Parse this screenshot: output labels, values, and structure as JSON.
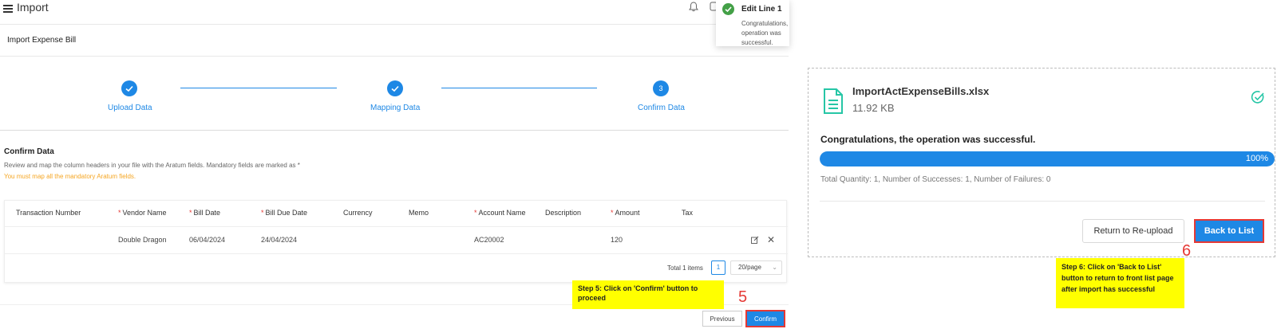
{
  "app": {
    "title": "Import"
  },
  "page": {
    "title": "Import Expense Bill"
  },
  "steps": [
    {
      "number": "1",
      "label": "Upload Data",
      "state": "done"
    },
    {
      "number": "2",
      "label": "Mapping Data",
      "state": "done"
    },
    {
      "number": "3",
      "label": "Confirm Data",
      "state": "current"
    }
  ],
  "confirm": {
    "heading": "Confirm Data",
    "description": "Review and map the column headers in your file with the Aratum fields. Mandatory fields are marked as *",
    "warning": "You must map all the mandatory Aratum fields."
  },
  "table": {
    "columns": [
      {
        "label": "Transaction Number",
        "required": false
      },
      {
        "label": "Vendor Name",
        "required": true
      },
      {
        "label": "Bill Date",
        "required": true
      },
      {
        "label": "Bill Due Date",
        "required": true
      },
      {
        "label": "Currency",
        "required": false
      },
      {
        "label": "Memo",
        "required": false
      },
      {
        "label": "Account Name",
        "required": true
      },
      {
        "label": "Description",
        "required": false
      },
      {
        "label": "Amount",
        "required": true
      },
      {
        "label": "Tax",
        "required": false
      }
    ],
    "rows": [
      [
        "",
        "Double Dragon",
        "06/04/2024",
        "24/04/2024",
        "",
        "",
        "AC20002",
        "",
        "120",
        ""
      ]
    ],
    "icons": {
      "edit": "edit-icon",
      "delete": "close-icon"
    }
  },
  "pagination": {
    "total": "Total 1 items",
    "page": "1",
    "page_size": "20/page"
  },
  "buttons": {
    "previous": "Previous",
    "confirm": "Confirm"
  },
  "toast": {
    "title": "Edit Line 1",
    "message": "Congratulations, the operation was successful."
  },
  "annotations": {
    "step5_note": "Step 5: Click on 'Confirm' button to proceed",
    "step5_number": "5",
    "step6_note": "Step 6: Click on 'Back to List' button to return to front list page after import has successful",
    "step6_number": "6"
  },
  "result": {
    "file_name": "ImportActExpenseBills.xlsx",
    "file_size": "11.92 KB",
    "success_message": "Congratulations, the operation was successful.",
    "progress_percent": 100,
    "progress_label": "100%",
    "stats": "Total Quantity: 1, Number of Successes: 1, Number of Failures: 0",
    "buttons": {
      "reupload": "Return to Re-upload",
      "back_to_list": "Back to List"
    }
  },
  "colors": {
    "primary": "#1e88e5",
    "success": "#43a047",
    "file_icon": "#26c6a6",
    "required": "#e53935",
    "warning": "#f5a623",
    "highlight": "#ffff00",
    "annotation_red": "#e53935"
  }
}
